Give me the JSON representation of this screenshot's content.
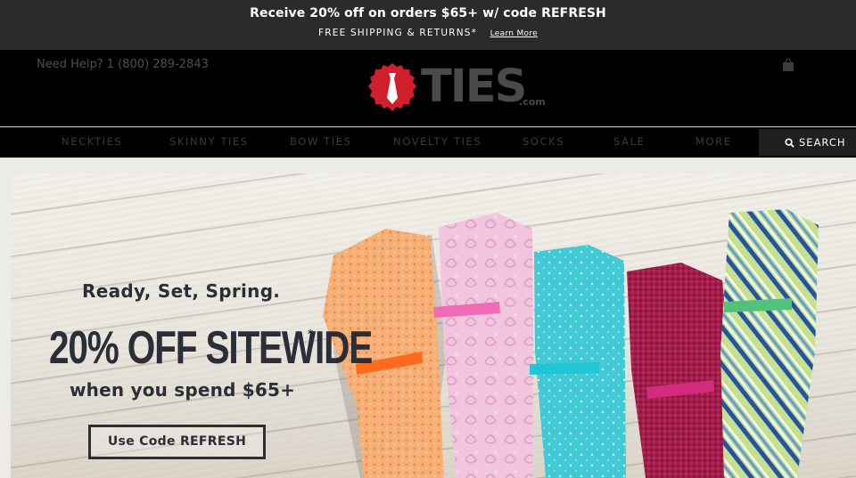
{
  "promo": {
    "headline": "Receive 20% off on orders $65+ w/ code REFRESH",
    "subline": "FREE SHIPPING & RETURNS*",
    "learn_more": "Learn More"
  },
  "header": {
    "help_text": "Need Help? 1 (800) 289-2843",
    "logo_word": "TIES",
    "logo_suffix": ".com",
    "bag_icon": "shopping-bag-icon"
  },
  "nav": {
    "items": [
      "NECKTIES",
      "SKINNY TIES",
      "BOW TIES",
      "NOVELTY TIES",
      "SOCKS",
      "SALE",
      "MORE"
    ],
    "search_label": "SEARCH",
    "search_icon": "search-icon"
  },
  "hero": {
    "tagline": "Ready, Set, Spring.",
    "offer": "20% OFF SITEWIDE",
    "asterisk": "*",
    "condition": "when you spend $65+",
    "cta": "Use Code REFRESH"
  },
  "colors": {
    "promo_bg": "#2b2b2b",
    "header_bg": "#000000",
    "logo_red": "#d0202e",
    "hero_text": "#2a2e36"
  }
}
